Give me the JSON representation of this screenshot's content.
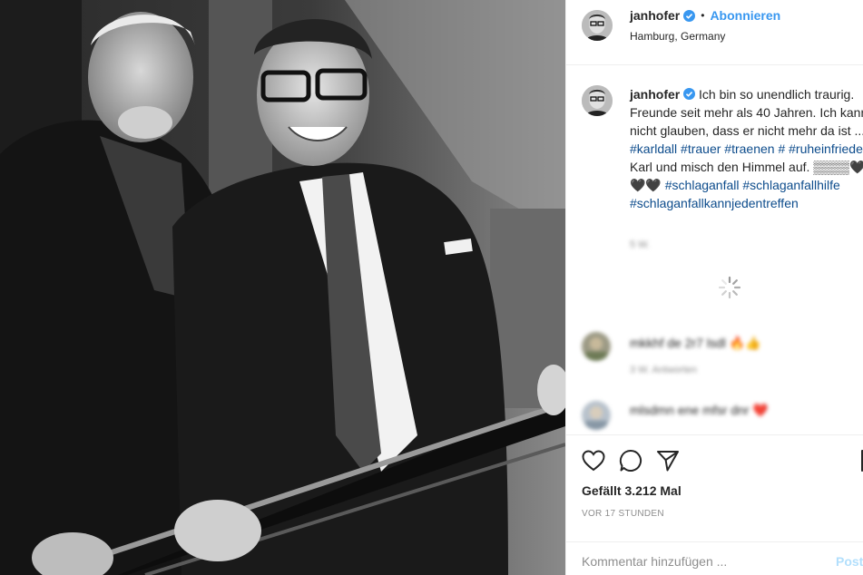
{
  "header": {
    "username": "janhofer",
    "separator": "•",
    "follow_label": "Abonnieren",
    "location": "Hamburg, Germany",
    "verified_icon": "verified-badge-icon"
  },
  "caption": {
    "username": "janhofer",
    "text_1": "Ich bin so unendlich traurig. Freunde seit mehr als 40 Jahren. Ich kann nicht glauben, dass er nicht mehr da ist ... ",
    "tags_1": [
      "#karldall",
      "#trauer",
      "#traenen",
      "#"
    ],
    "tag_2": "#ruheinfrieden",
    "text_2": " Karl und misch den Himmel auf. ",
    "emoji": "▒▒▒▒🖤🖤🖤 ",
    "tag_3": "#schlaganfall",
    "tag_4": "#schlaganfallhilfe",
    "tag_5": "#schlaganfallkannjedentreffen",
    "meta": "5 W."
  },
  "comments": [
    {
      "text": "mkkhf  de 2r7 lsdl  🔥👍",
      "sub": "3 W.   Antworten"
    },
    {
      "text": "mlsdmn ene mfsr dnr ❤️",
      "sub": ""
    }
  ],
  "actions": {
    "like_icon": "heart-icon",
    "comment_icon": "comment-icon",
    "share_icon": "share-icon",
    "save_icon": "bookmark-icon",
    "likes_text": "Gefällt 3.212 Mal",
    "time_text": "VOR 17 STUNDEN"
  },
  "comment_box": {
    "placeholder": "Kommentar hinzufügen ...",
    "post_label": "Posten"
  },
  "colors": {
    "accent": "#3897f0",
    "hashtag": "#0d4c8c",
    "muted": "#8e8e8e",
    "border": "#efefef"
  }
}
